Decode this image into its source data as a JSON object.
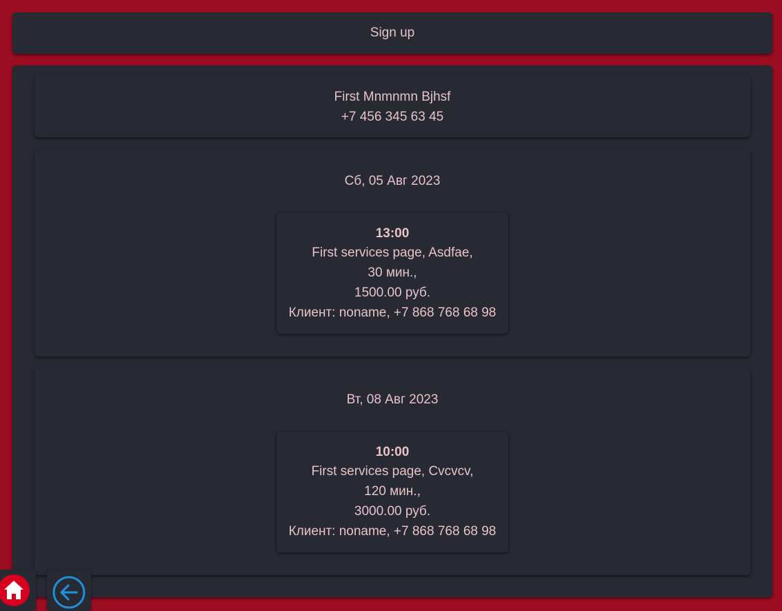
{
  "header": {
    "title": "Sign up"
  },
  "profile": {
    "name": "First Mnmnmn Bjhsf",
    "phone": "+7 456 345 63 45"
  },
  "days": [
    {
      "date": "Сб, 05 Авг 2023",
      "appointment": {
        "time": "13:00",
        "service": "First services page, Asdfae,",
        "duration": "30 мин.,",
        "price": "1500.00 руб.",
        "client": "Клиент: noname, +7 868 768 68 98"
      }
    },
    {
      "date": "Вт, 08 Авг 2023",
      "appointment": {
        "time": "10:00",
        "service": "First services page, Cvcvcv,",
        "duration": "120 мин.,",
        "price": "3000.00 руб.",
        "client": "Клиент: noname, +7 868 768 68 98"
      }
    }
  ],
  "nav": {
    "home_icon": "home-icon",
    "back_icon": "arrow-left-circle-icon"
  },
  "colors": {
    "background": "#9c0d22",
    "card": "#272a33",
    "text": "#e7c3c8",
    "home_accent": "#d8001e",
    "back_accent": "#1f8fd6"
  }
}
